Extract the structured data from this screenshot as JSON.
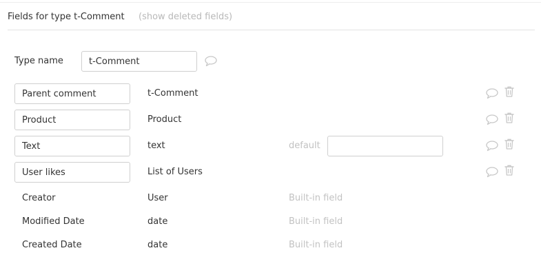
{
  "header": {
    "title": "Fields for type t-Comment",
    "show_deleted_link": "(show deleted fields)"
  },
  "type_name": {
    "label": "Type name",
    "value": "t-Comment"
  },
  "custom_fields": [
    {
      "name": "Parent comment",
      "type": "t-Comment"
    },
    {
      "name": "Product",
      "type": "Product"
    },
    {
      "name": "Text",
      "type": "text",
      "default_label": "default",
      "default_value": ""
    },
    {
      "name": "User likes",
      "type": "List of Users"
    }
  ],
  "builtin_fields": [
    {
      "name": "Creator",
      "type": "User",
      "note": "Built-in field"
    },
    {
      "name": "Modified Date",
      "type": "date",
      "note": "Built-in field"
    },
    {
      "name": "Created Date",
      "type": "date",
      "note": "Built-in field"
    }
  ],
  "icons": {
    "comment": "comment-icon",
    "delete": "trash-icon"
  },
  "colors": {
    "icon_gray": "#c7c7c7",
    "muted_text": "#c2c2c2",
    "border": "#cfcfcf"
  }
}
